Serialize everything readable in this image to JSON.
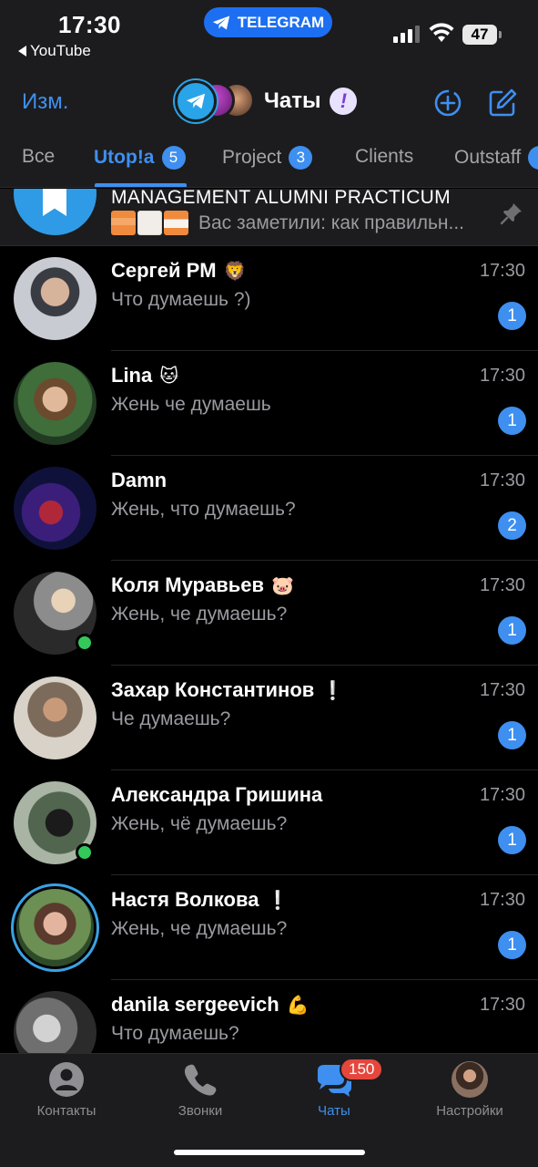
{
  "status_bar": {
    "time": "17:30",
    "back_app": "YouTube",
    "pill_label": "TELEGRAM",
    "battery": "47"
  },
  "header": {
    "edit_label": "Изм.",
    "title": "Чаты",
    "title_badge": "!",
    "new_story_icon": "circle-plus-icon",
    "compose_icon": "compose-icon"
  },
  "folders": [
    {
      "label": "Все",
      "count": null,
      "active": false
    },
    {
      "label": "Utop!a",
      "count": "5",
      "active": true
    },
    {
      "label": "Project",
      "count": "3",
      "active": false
    },
    {
      "label": "Clients",
      "count": null,
      "active": false
    },
    {
      "label": "Outstaff",
      "count": null,
      "active": false
    }
  ],
  "pinned": {
    "name": "MANAGEMENT ALUMNI PRACTICUM",
    "preview": "Вас заметили: как правильн..."
  },
  "chats": [
    {
      "name": "Сергей PM",
      "emoji": "🦁",
      "preview": "Что думаешь ?)",
      "time": "17:30",
      "unread": "1"
    },
    {
      "name": "Lina",
      "emoji": "🐱",
      "preview": "Жень че думаешь",
      "time": "17:30",
      "unread": "1"
    },
    {
      "name": "Damn",
      "emoji": "",
      "preview": "Жень, что думаешь?",
      "time": "17:30",
      "unread": "2"
    },
    {
      "name": "Коля Муравьев",
      "emoji": "🐷",
      "preview": "Жень, че думаешь?",
      "time": "17:30",
      "unread": "1"
    },
    {
      "name": "Захар Константинов",
      "emoji": "❕",
      "preview": "Че думаешь?",
      "time": "17:30",
      "unread": "1"
    },
    {
      "name": "Александра Гришина",
      "emoji": "",
      "preview": "Жень, чё думаешь?",
      "time": "17:30",
      "unread": "1"
    },
    {
      "name": "Настя Волкова",
      "emoji": "❕",
      "preview": "Жень, че думаешь?",
      "time": "17:30",
      "unread": "1"
    },
    {
      "name": "danila sergeevich",
      "emoji": "💪",
      "preview": "Что думаешь?",
      "time": "17:30",
      "unread": ""
    }
  ],
  "tab_bar": {
    "contacts": "Контакты",
    "calls": "Звонки",
    "chats": "Чаты",
    "chats_badge": "150",
    "settings": "Настройки"
  },
  "colors": {
    "accent": "#3e8ff0",
    "background": "#000000",
    "panel": "#1c1c1e",
    "online": "#34c759",
    "badge_red": "#e5473d"
  }
}
